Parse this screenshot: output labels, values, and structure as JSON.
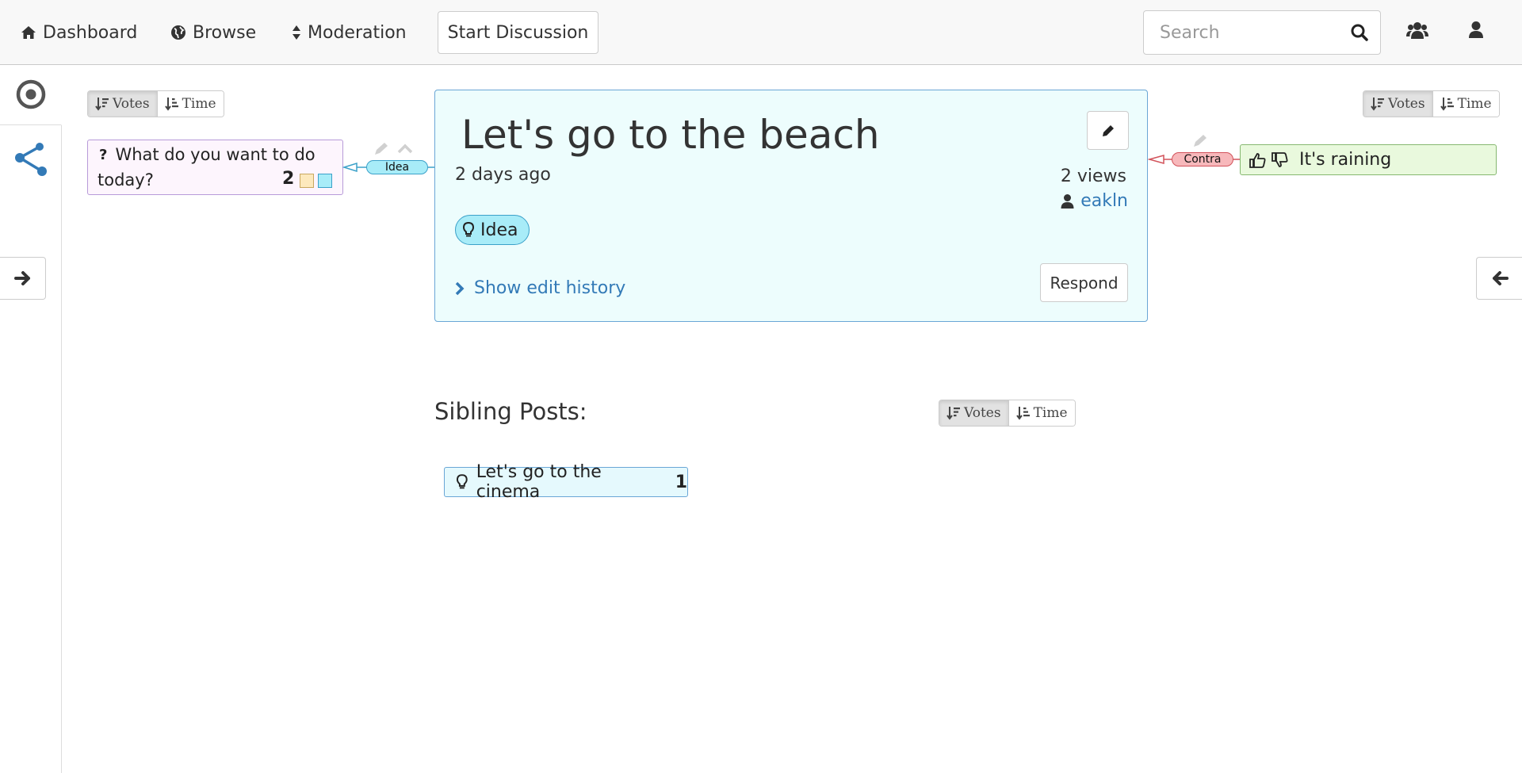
{
  "nav": {
    "dashboard": "Dashboard",
    "browse": "Browse",
    "moderation": "Moderation",
    "start_discussion": "Start Discussion",
    "search_placeholder": "Search",
    "icons": [
      "home-icon",
      "globe-icon",
      "sort-icon",
      "search-icon",
      "users-icon",
      "user-icon"
    ]
  },
  "sort": {
    "votes": "Votes",
    "time": "Time"
  },
  "parent": {
    "question_mark": "?",
    "line1": "What do you want to do",
    "line2": "today?",
    "votes": "2",
    "relation": "Idea",
    "square_colors": [
      "#fde9bd",
      "#a8ecf8"
    ]
  },
  "post": {
    "title": "Let's go to the beach",
    "time_ago": "2 days ago",
    "views": "2 views",
    "author": "eakln",
    "tag": "Idea",
    "history_link": "Show edit history",
    "respond": "Respond"
  },
  "response": {
    "relation": "Contra",
    "text": "It's raining"
  },
  "siblings": {
    "heading": "Sibling Posts:",
    "items": [
      {
        "text": "Let's go to the cinema",
        "votes": "1"
      }
    ]
  },
  "colors": {
    "accent_link": "#337ab7",
    "idea_bg": "#a8ecf8",
    "question_bg": "#fdf5fd",
    "question_border": "#b79bd9",
    "contra_bg": "#f7b8bb",
    "pro_card_bg": "#e9f9dd"
  }
}
